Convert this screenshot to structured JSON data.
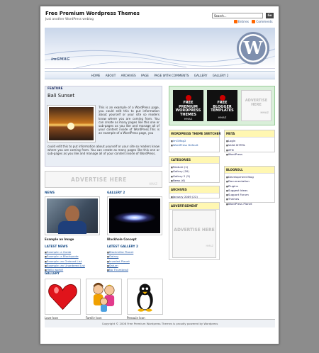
{
  "header": {
    "site_title": "Free Premium Wordpress Themes",
    "site_description": "Just another WordPress weblog",
    "search_value": "Search...",
    "search_button": "Go",
    "feed_entries": "Entries",
    "feed_comments": "Comments",
    "banner_logo": "imGMAG"
  },
  "nav": {
    "items": [
      "HOME",
      "ABOUT",
      "ARCHIVES",
      "PAGE",
      "PAGE WITH COMMENTS",
      "GALLERY",
      "GALLERY 2"
    ]
  },
  "feature": {
    "label": "FEATURE",
    "post_title": "Bali Sunset",
    "text_side": "This is an example of a WordPress page, you could edit this to put information about yourself or your site so readers know where you are coming from. You can create as many pages like this one or sub-pages as you like and manage all of your content inside of WordPress.This is an example of a WordPress page, you",
    "text_bottom": "could edit this to put information about yourself or your site so readers know where you are coming from. You can create as many pages like this one or sub-pages as you like and manage all of your content inside of WordPress."
  },
  "ads": {
    "wide_text": "ADVERTISE HERE",
    "small_text": "HMAZ",
    "box_text": "ADVERTISE HERE"
  },
  "news": {
    "head": "NEWS",
    "caption": "Example an Image"
  },
  "gallery2": {
    "head": "GALLERY 2",
    "caption": "Blackhole Concept"
  },
  "latest_news": {
    "head": "LATEST NEWS",
    "items": [
      "Example: a Guide",
      "Example: a Blockquote",
      "Example: an Ordered List",
      "Example: an Unordered List",
      "Hello world!"
    ]
  },
  "latest_gallery2": {
    "head": "LATEST GALLERY 2",
    "items": [
      "Blackmilke Planet",
      "Galaxy",
      "Invaded Planet",
      "Saturn",
      "No Thumbnail"
    ]
  },
  "gallery": {
    "head": "GALLERY",
    "captions": [
      "Love Icon",
      "Family Icon",
      "Penguin Icon"
    ]
  },
  "promo_tiles": {
    "tile1": [
      "FREE",
      "PREMIUM",
      "WORDPRESS",
      "THEMES"
    ],
    "tile2": [
      "FREE",
      "BLOGGER",
      "TEMPLATES"
    ],
    "tile_footer": "HMAZ",
    "tile3": [
      "ADVERTISE",
      "HERE"
    ]
  },
  "widgets": {
    "theme_switcher": {
      "head": "WORDPRESS THEME SWITCHER",
      "items": [
        "imGMag2",
        "WordPress Default"
      ]
    },
    "categories": {
      "head": "CATEGORIES",
      "items": [
        "Feature (1)",
        "Gallery (20)",
        "Gallery 2 (5)",
        "News (6)"
      ]
    },
    "archives": {
      "head": "ARCHIVES",
      "items": [
        "January 2009 (22)"
      ]
    },
    "advertisement": {
      "head": "ADVERTISEMENT"
    },
    "meta": {
      "head": "META",
      "items": [
        "Login",
        "Valid XHTML",
        "XFN",
        "WordPress"
      ]
    },
    "blogroll": {
      "head": "BLOGROLL",
      "items": [
        "Development Blog",
        "Documentation",
        "Plugins",
        "Suggest Ideas",
        "Support Forum",
        "Themes",
        "WordPress Planet"
      ]
    }
  },
  "footer": {
    "text": "Copyright © 2008 Free Premium Wordpress Themes is proudly powered by Wordpress"
  },
  "colors": {
    "accent_blue": "#1a4f8a",
    "widget_head": "#fff7b2",
    "promo_green": "#d9efd9"
  }
}
